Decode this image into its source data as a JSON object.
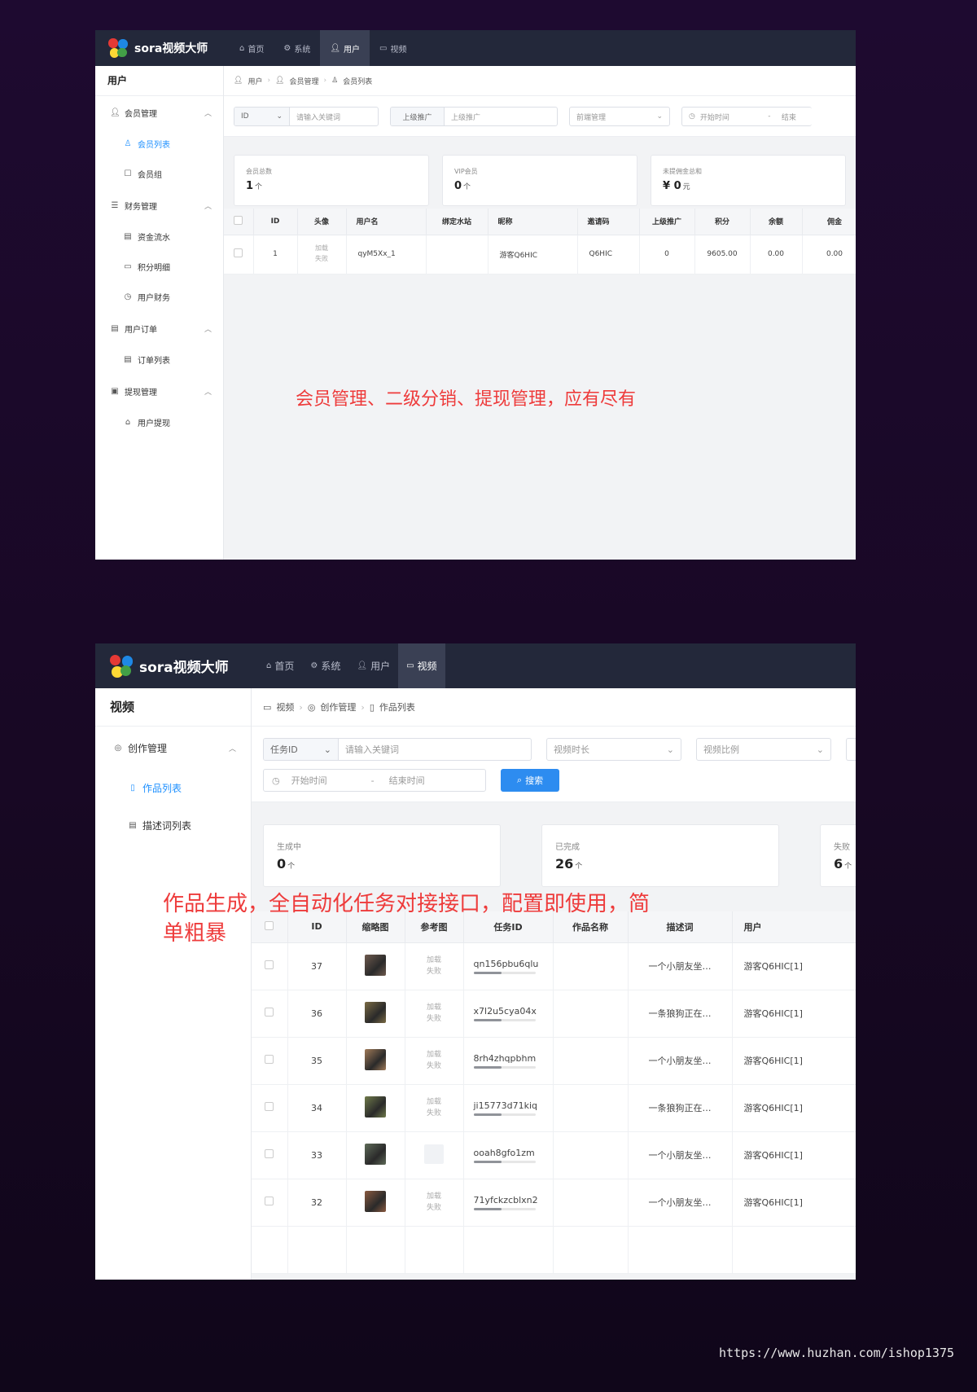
{
  "screen1": {
    "brand": "sora视频大师",
    "nav": [
      {
        "label": "首页",
        "icon": "home-icon",
        "active": false
      },
      {
        "label": "系统",
        "icon": "gear-icon",
        "active": false
      },
      {
        "label": "用户",
        "icon": "user-icon",
        "active": true
      },
      {
        "label": "视频",
        "icon": "video-icon",
        "active": false
      }
    ],
    "sidebar": {
      "title": "用户",
      "groups": [
        {
          "label": "会员管理",
          "icon": "user-icon",
          "items": [
            {
              "label": "会员列表",
              "icon": "user-outline-icon",
              "active": true
            },
            {
              "label": "会员组",
              "icon": "share-box-icon"
            }
          ]
        },
        {
          "label": "财务管理",
          "icon": "database-icon",
          "items": [
            {
              "label": "资金流水",
              "icon": "document-icon"
            },
            {
              "label": "积分明细",
              "icon": "message-icon"
            },
            {
              "label": "用户财务",
              "icon": "clock-icon"
            }
          ]
        },
        {
          "label": "用户订单",
          "icon": "order-icon",
          "items": [
            {
              "label": "订单列表",
              "icon": "document-icon"
            }
          ]
        },
        {
          "label": "提现管理",
          "icon": "wallet-icon",
          "items": [
            {
              "label": "用户提现",
              "icon": "withdraw-icon"
            }
          ]
        }
      ]
    },
    "breadcrumb": [
      "用户",
      "会员管理",
      "会员列表"
    ],
    "filters": {
      "id_select": "ID",
      "keyword_placeholder": "请输入关键词",
      "parent_label": "上级推广",
      "parent_placeholder": "上级推广",
      "frontend_placeholder": "前端管理",
      "start_placeholder": "开始时间",
      "range_sep": "-",
      "end_placeholder": "结束"
    },
    "stats": [
      {
        "label": "会员总数",
        "value": "1",
        "unit": "个",
        "prefix": ""
      },
      {
        "label": "VIP会员",
        "value": "0",
        "unit": "个",
        "prefix": ""
      },
      {
        "label": "未提佣金总和",
        "value": "0",
        "unit": "元",
        "prefix": "¥"
      }
    ],
    "table": {
      "headers": [
        "",
        "ID",
        "头像",
        "用户名",
        "绑定水站",
        "昵称",
        "邀请码",
        "上级推广",
        "积分",
        "余额",
        "佣金"
      ],
      "rows": [
        {
          "id": "1",
          "avatar_l1": "加载",
          "avatar_l2": "失败",
          "username": "qyM5Xx_1",
          "station": "",
          "nickname": "游客Q6HIC",
          "invite": "Q6HIC",
          "parent": "0",
          "points": "9605.00",
          "balance": "0.00",
          "commission": "0.00"
        }
      ]
    },
    "caption": "会员管理、二级分销、提现管理，应有尽有"
  },
  "screen2": {
    "brand": "sora视频大师",
    "nav": [
      {
        "label": "首页",
        "icon": "home-icon",
        "active": false
      },
      {
        "label": "系统",
        "icon": "gear-icon",
        "active": false
      },
      {
        "label": "用户",
        "icon": "user-icon",
        "active": false
      },
      {
        "label": "视频",
        "icon": "video-icon",
        "active": true
      }
    ],
    "sidebar": {
      "title": "视频",
      "groups": [
        {
          "label": "创作管理",
          "icon": "create-icon",
          "items": [
            {
              "label": "作品列表",
              "icon": "file-icon",
              "active": true
            },
            {
              "label": "描述词列表",
              "icon": "document-icon"
            }
          ]
        }
      ]
    },
    "breadcrumb": [
      "视频",
      "创作管理",
      "作品列表"
    ],
    "filters": {
      "task_select": "任务ID",
      "keyword_placeholder": "请输入关键词",
      "duration_placeholder": "视频时长",
      "ratio_placeholder": "视频比例",
      "start_placeholder": "开始时间",
      "range_sep": "-",
      "end_placeholder": "结束时间",
      "search_label": "搜索"
    },
    "stats": [
      {
        "label": "生成中",
        "value": "0",
        "unit": "个"
      },
      {
        "label": "已完成",
        "value": "26",
        "unit": "个"
      },
      {
        "label": "失败",
        "value": "6",
        "unit": "个"
      }
    ],
    "table": {
      "headers": [
        "",
        "ID",
        "缩略图",
        "参考图",
        "任务ID",
        "作品名称",
        "描述词",
        "用户"
      ],
      "rows": [
        {
          "id": "37",
          "ref_failed": true,
          "task": "qn156pbu6qlu",
          "progress": 0.45,
          "name": "",
          "desc": "一个小朋友坐…",
          "user": "游客Q6HIC[1]",
          "thumb": "#6e5a4e"
        },
        {
          "id": "36",
          "ref_failed": true,
          "task": "x7l2u5cya04x",
          "progress": 0.45,
          "name": "",
          "desc": "一条狼狗正在…",
          "user": "游客Q6HIC[1]",
          "thumb": "#7a6a44"
        },
        {
          "id": "35",
          "ref_failed": true,
          "task": "8rh4zhqpbhm",
          "progress": 0.45,
          "name": "",
          "desc": "一个小朋友坐…",
          "user": "游客Q6HIC[1]",
          "thumb": "#a07a58"
        },
        {
          "id": "34",
          "ref_failed": true,
          "task": "ji15773d71kiq",
          "progress": 0.45,
          "name": "",
          "desc": "一条狼狗正在…",
          "user": "游客Q6HIC[1]",
          "thumb": "#6f7a4a"
        },
        {
          "id": "33",
          "ref_failed": false,
          "task": "ooah8gfo1zm",
          "progress": 0.45,
          "name": "",
          "desc": "一个小朋友坐…",
          "user": "游客Q6HIC[1]",
          "thumb": "#5e6a58"
        },
        {
          "id": "32",
          "ref_failed": true,
          "task": "71yfckzcblxn2",
          "progress": 0.45,
          "name": "",
          "desc": "一个小朋友坐…",
          "user": "游客Q6HIC[1]",
          "thumb": "#8a5a40"
        }
      ],
      "ref_failed_l1": "加载",
      "ref_failed_l2": "失败"
    },
    "caption_line1": "作品生成，全自动化任务对接接口，配置即使用，简",
    "caption_line2": "单粗暴"
  },
  "watermark": "https://www.huzhan.com/ishop1375"
}
